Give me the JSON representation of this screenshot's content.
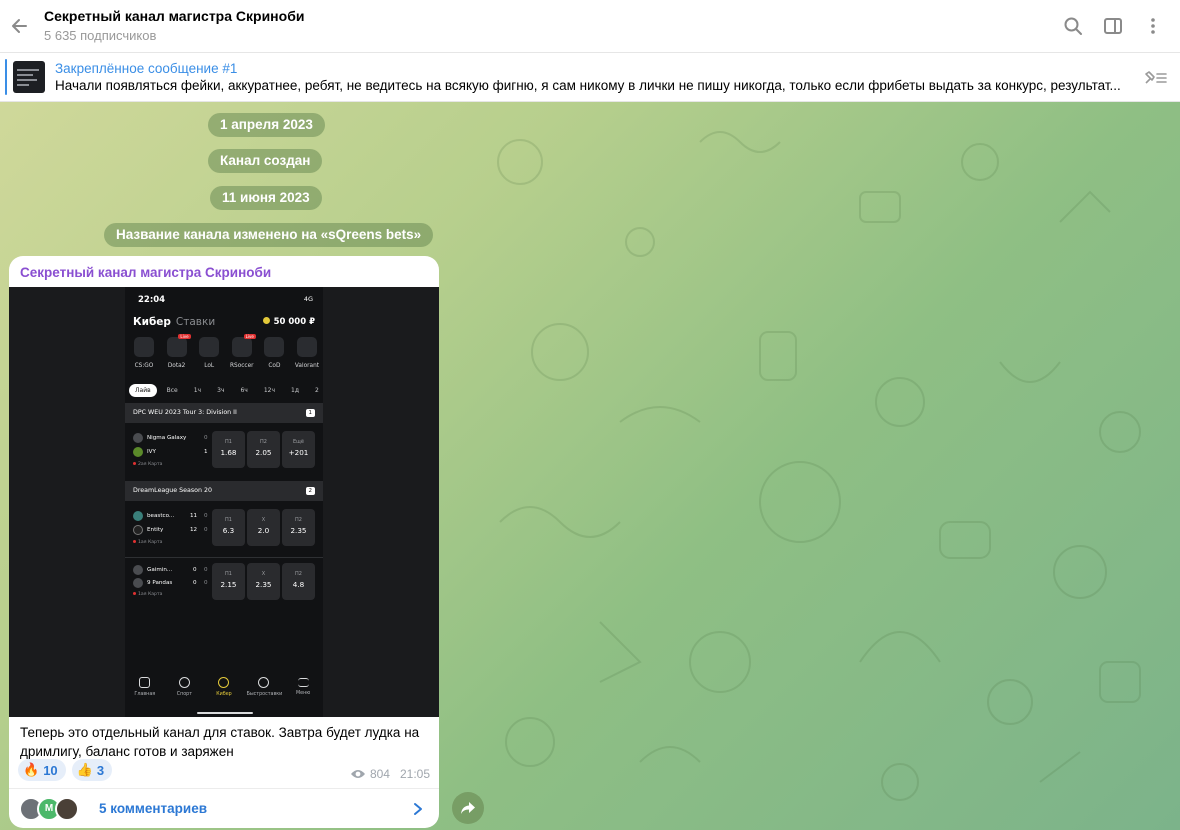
{
  "header": {
    "title": "Секретный канал магистра Скриноби",
    "subtitle": "5 635 подписчиков",
    "icons": [
      "back-arrow-icon",
      "search-icon",
      "sidebar-toggle-icon",
      "more-vertical-icon"
    ]
  },
  "pinned": {
    "title": "Закреплённое сообщение #1",
    "text": "Начали появляться фейки, аккуратнее, ребят, не ведитесь на всякую фигню, я сам никому в лички не пишу никогда, только если фрибеты выдать за конкурс, результат..."
  },
  "service": {
    "date1": "1 апреля 2023",
    "created": "Канал создан",
    "date2": "11 июня 2023",
    "renamed": "Название канала изменено на «sQreens bets»"
  },
  "message": {
    "author": "Секретный канал магистра Скриноби",
    "text": "Теперь это отдельный канал для ставок. Завтра будет лудка на дримлигу, баланс готов и заряжен",
    "reactions": [
      {
        "emoji": "🔥",
        "count": "10"
      },
      {
        "emoji": "👍",
        "count": "3"
      }
    ],
    "views": "804",
    "time": "21:05",
    "comments_label": "5 комментариев",
    "avatar_letter": "M"
  },
  "screenshot": {
    "status_time": "22:04",
    "status_right": "4G",
    "tab_active": "Кибер",
    "tab_inactive": "Ставки",
    "balance": "50 000 ₽",
    "games": [
      {
        "name": "CS:GO",
        "live": ""
      },
      {
        "name": "Dota2",
        "live": "Live"
      },
      {
        "name": "LoL",
        "live": ""
      },
      {
        "name": "RSoccer",
        "live": "Live"
      },
      {
        "name": "CoD",
        "live": ""
      },
      {
        "name": "Valorant",
        "live": ""
      }
    ],
    "filters": [
      "Лайв",
      "Все",
      "1ч",
      "3ч",
      "6ч",
      "12ч",
      "1д",
      "2"
    ],
    "league1": {
      "name": "DPC WEU 2023 Tour 3: Division II",
      "count": "1"
    },
    "match1": {
      "team1": "Nigma Galaxy",
      "score1": "0",
      "team2": "IVY",
      "score2": "1",
      "map": "2ая Карта",
      "odds": [
        {
          "label": "П1",
          "value": "1.68"
        },
        {
          "label": "П2",
          "value": "2.05"
        },
        {
          "label": "Ещё",
          "value": "+201"
        }
      ]
    },
    "league2": {
      "name": "DreamLeague Season 20",
      "count": "2"
    },
    "match2": {
      "team1": "beastco...",
      "score1a": "11",
      "score1b": "0",
      "team2": "Entity",
      "score2a": "12",
      "score2b": "0",
      "map": "1ая Карта",
      "odds": [
        {
          "label": "П1",
          "value": "6.3"
        },
        {
          "label": "Х",
          "value": "2.0"
        },
        {
          "label": "П2",
          "value": "2.35"
        }
      ]
    },
    "match3": {
      "team1": "Gaimin...",
      "score1a": "0",
      "score1b": "0",
      "team2": "9 Pandas",
      "score2a": "0",
      "score2b": "0",
      "map": "1ая Карта",
      "odds": [
        {
          "label": "П1",
          "value": "2.15"
        },
        {
          "label": "Х",
          "value": "2.35"
        },
        {
          "label": "П2",
          "value": "4.8"
        }
      ]
    },
    "nav": [
      "Главная",
      "Спорт",
      "Кибер",
      "Быстроставки",
      "Меню"
    ]
  },
  "colors": {
    "accent": "#3a8ee6",
    "author": "#8a4fd1",
    "link": "#2c78d4",
    "service_bg": "#6b8c55"
  }
}
